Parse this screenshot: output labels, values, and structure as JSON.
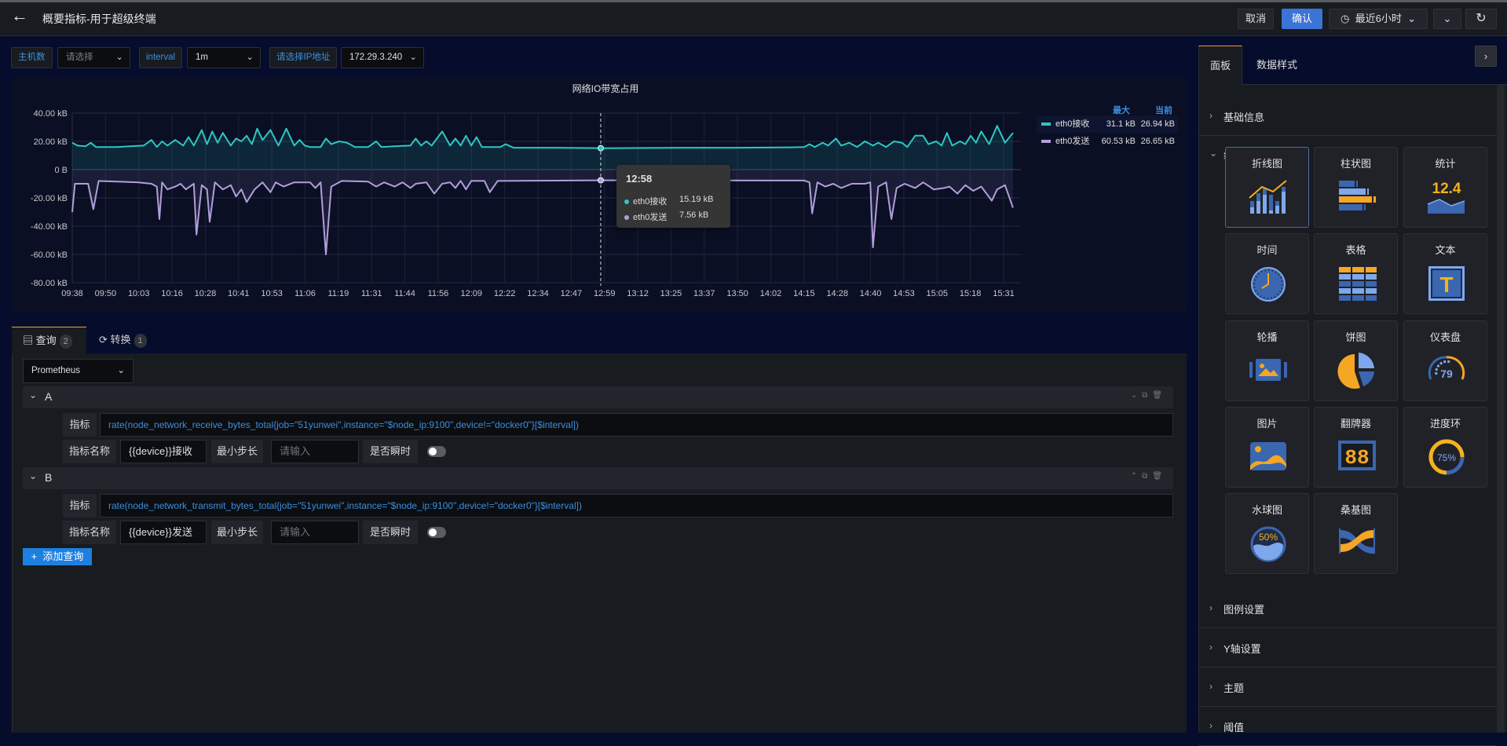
{
  "header": {
    "title": "概要指标-用于超级终端",
    "cancel": "取消",
    "confirm": "确认",
    "time_range": "最近6小时",
    "time_icon": "clock-icon",
    "refresh_icon": "refresh-icon"
  },
  "filters": [
    {
      "label": "主机数",
      "value": "请选择",
      "is_placeholder": true
    },
    {
      "label": "interval",
      "value": "1m"
    },
    {
      "label": "请选择IP地址",
      "value": "172.29.3.240"
    }
  ],
  "chart_data": {
    "type": "line",
    "title": "网络IO带宽占用",
    "ylim": [
      -80,
      40
    ],
    "yticks": [
      "40.00 kB",
      "20.00 kB",
      "0 B",
      "-20.00 kB",
      "-40.00 kB",
      "-60.00 kB",
      "-80.00 kB"
    ],
    "ytick_values": [
      40,
      20,
      0,
      -20,
      -40,
      -60,
      -80
    ],
    "xlim": [
      "09:38",
      "15:37"
    ],
    "xticks": [
      "09:38",
      "09:50",
      "10:03",
      "10:16",
      "10:28",
      "10:41",
      "10:53",
      "11:06",
      "11:19",
      "11:31",
      "11:44",
      "11:56",
      "12:09",
      "12:22",
      "12:34",
      "12:47",
      "12:59",
      "13:12",
      "13:25",
      "13:37",
      "13:50",
      "14:02",
      "14:15",
      "14:28",
      "14:40",
      "14:53",
      "15:05",
      "15:18",
      "15:31"
    ],
    "grid": true,
    "legend_position": "right",
    "legend_headers": {
      "max": "最大",
      "current": "当前"
    },
    "series": [
      {
        "name": "eth0接收",
        "color": "#2cc7c4",
        "max": "31.1 kB",
        "current": "26.94 kB",
        "points": [
          [
            "09:38",
            19
          ],
          [
            "09:40",
            17
          ],
          [
            "09:43",
            16.5
          ],
          [
            "09:45",
            19
          ],
          [
            "09:47",
            16
          ],
          [
            "09:55",
            16
          ],
          [
            "10:00",
            16.5
          ],
          [
            "10:05",
            17
          ],
          [
            "10:08",
            21
          ],
          [
            "10:10",
            16
          ],
          [
            "10:12",
            20
          ],
          [
            "10:14",
            17
          ],
          [
            "10:17",
            21
          ],
          [
            "10:20",
            17
          ],
          [
            "10:22",
            23
          ],
          [
            "10:24",
            17
          ],
          [
            "10:27",
            28
          ],
          [
            "10:29",
            18
          ],
          [
            "10:31",
            27
          ],
          [
            "10:33",
            19
          ],
          [
            "10:35",
            26
          ],
          [
            "10:38",
            17
          ],
          [
            "10:40",
            22
          ],
          [
            "10:42",
            20
          ],
          [
            "10:44",
            24
          ],
          [
            "10:46",
            18
          ],
          [
            "10:48",
            29
          ],
          [
            "10:50",
            21
          ],
          [
            "10:53",
            28
          ],
          [
            "10:56",
            17
          ],
          [
            "10:59",
            29
          ],
          [
            "11:02",
            17
          ],
          [
            "11:04",
            21
          ],
          [
            "11:06",
            17
          ],
          [
            "11:08",
            16
          ],
          [
            "11:12",
            16
          ],
          [
            "11:14",
            22
          ],
          [
            "11:16",
            18
          ],
          [
            "11:19",
            20
          ],
          [
            "11:22",
            19
          ],
          [
            "11:25",
            16
          ],
          [
            "11:30",
            16
          ],
          [
            "11:33",
            20
          ],
          [
            "11:35",
            16
          ],
          [
            "11:40",
            16.5
          ],
          [
            "11:46",
            17
          ],
          [
            "11:48",
            22
          ],
          [
            "11:50",
            17
          ],
          [
            "11:52",
            20
          ],
          [
            "11:54",
            17
          ],
          [
            "11:58",
            27
          ],
          [
            "12:01",
            17
          ],
          [
            "12:03",
            22
          ],
          [
            "12:05",
            17
          ],
          [
            "12:07",
            24
          ],
          [
            "12:09",
            17
          ],
          [
            "12:11",
            23
          ],
          [
            "12:13",
            16
          ],
          [
            "12:20",
            16
          ],
          [
            "12:22",
            18
          ],
          [
            "12:25",
            15.5
          ],
          [
            "12:40",
            15.5
          ],
          [
            "12:58",
            15.19
          ],
          [
            "13:10",
            15.3
          ],
          [
            "13:30",
            15.5
          ],
          [
            "13:50",
            15.5
          ],
          [
            "14:10",
            15.8
          ],
          [
            "14:15",
            16
          ],
          [
            "14:17",
            18
          ],
          [
            "14:19",
            16
          ],
          [
            "14:22",
            19
          ],
          [
            "14:24",
            17
          ],
          [
            "14:27",
            22
          ],
          [
            "14:29",
            17
          ],
          [
            "14:32",
            19
          ],
          [
            "14:35",
            16
          ],
          [
            "14:38",
            20
          ],
          [
            "14:41",
            17
          ],
          [
            "14:43",
            19
          ],
          [
            "14:46",
            16
          ],
          [
            "14:49",
            20
          ],
          [
            "14:52",
            19
          ],
          [
            "14:54",
            16
          ],
          [
            "14:57",
            24
          ],
          [
            "15:00",
            24
          ],
          [
            "15:02",
            18
          ],
          [
            "15:05",
            20
          ],
          [
            "15:07",
            17
          ],
          [
            "15:09",
            26
          ],
          [
            "15:11",
            17
          ],
          [
            "15:14",
            20
          ],
          [
            "15:16",
            18
          ],
          [
            "15:18",
            24
          ],
          [
            "15:20",
            19
          ],
          [
            "15:22",
            27
          ],
          [
            "15:25",
            18
          ],
          [
            "15:28",
            31
          ],
          [
            "15:31",
            19
          ],
          [
            "15:34",
            26
          ]
        ]
      },
      {
        "name": "eth0发送",
        "color": "#b39ddb",
        "max": "60.53 kB",
        "current": "26.65 kB",
        "points": [
          [
            "09:38",
            -30
          ],
          [
            "09:39",
            -10
          ],
          [
            "09:44",
            -10
          ],
          [
            "09:46",
            -28
          ],
          [
            "09:48",
            -8
          ],
          [
            "09:55",
            -8.5
          ],
          [
            "10:03",
            -9
          ],
          [
            "10:08",
            -10
          ],
          [
            "10:10",
            -12
          ],
          [
            "10:11",
            -35
          ],
          [
            "10:12",
            -9
          ],
          [
            "10:14",
            -14
          ],
          [
            "10:17",
            -12
          ],
          [
            "10:19",
            -10
          ],
          [
            "10:21",
            -14
          ],
          [
            "10:24",
            -10
          ],
          [
            "10:25",
            -46
          ],
          [
            "10:27",
            -11
          ],
          [
            "10:29",
            -14
          ],
          [
            "10:30",
            -37
          ],
          [
            "10:32",
            -9
          ],
          [
            "10:35",
            -14
          ],
          [
            "10:38",
            -11
          ],
          [
            "10:40",
            -19
          ],
          [
            "10:42",
            -14
          ],
          [
            "10:44",
            -23
          ],
          [
            "10:47",
            -14
          ],
          [
            "10:50",
            -9
          ],
          [
            "10:53",
            -16
          ],
          [
            "10:55",
            -9
          ],
          [
            "10:58",
            -12
          ],
          [
            "11:02",
            -9
          ],
          [
            "11:08",
            -9
          ],
          [
            "11:10",
            -13
          ],
          [
            "11:12",
            -9
          ],
          [
            "11:14",
            -60
          ],
          [
            "11:16",
            -12
          ],
          [
            "11:20",
            -8
          ],
          [
            "11:30",
            -8.5
          ],
          [
            "11:33",
            -12
          ],
          [
            "11:36",
            -9
          ],
          [
            "11:40",
            -12
          ],
          [
            "11:43",
            -9
          ],
          [
            "11:46",
            -13
          ],
          [
            "11:48",
            -10
          ],
          [
            "11:52",
            -9
          ],
          [
            "11:55",
            -17
          ],
          [
            "11:58",
            -10
          ],
          [
            "12:01",
            -9
          ],
          [
            "12:03",
            -13
          ],
          [
            "12:05",
            -8
          ],
          [
            "12:07",
            -14
          ],
          [
            "12:09",
            -8
          ],
          [
            "12:14",
            -8
          ],
          [
            "12:16",
            -16
          ],
          [
            "12:19",
            -8
          ],
          [
            "12:40",
            -7.8
          ],
          [
            "12:58",
            -7.56
          ],
          [
            "13:30",
            -7.6
          ],
          [
            "14:00",
            -7.7
          ],
          [
            "14:15",
            -7.7
          ],
          [
            "14:17",
            -9
          ],
          [
            "14:18",
            -31
          ],
          [
            "14:20",
            -9
          ],
          [
            "14:23",
            -12
          ],
          [
            "14:26",
            -10
          ],
          [
            "14:29",
            -13
          ],
          [
            "14:33",
            -10
          ],
          [
            "14:38",
            -10
          ],
          [
            "14:40",
            -9
          ],
          [
            "14:41",
            -55
          ],
          [
            "14:43",
            -12
          ],
          [
            "14:46",
            -9
          ],
          [
            "14:48",
            -35
          ],
          [
            "14:50",
            -13
          ],
          [
            "14:53",
            -10
          ],
          [
            "14:57",
            -13
          ],
          [
            "15:00",
            -9
          ],
          [
            "15:04",
            -14
          ],
          [
            "15:08",
            -13
          ],
          [
            "15:10",
            -12
          ],
          [
            "15:13",
            -17
          ],
          [
            "15:16",
            -11
          ],
          [
            "15:19",
            -15
          ],
          [
            "15:22",
            -12
          ],
          [
            "15:26",
            -22
          ],
          [
            "15:28",
            -14
          ],
          [
            "15:31",
            -11
          ],
          [
            "15:34",
            -27
          ]
        ]
      }
    ],
    "tooltip": {
      "time": "12:58",
      "items": [
        {
          "name": "eth0接收",
          "value": "15.19 kB"
        },
        {
          "name": "eth0发送",
          "value": "7.56 kB"
        }
      ]
    }
  },
  "query": {
    "tabs": [
      {
        "label": "查询",
        "count": "2",
        "icon": "list-icon"
      },
      {
        "label": "转换",
        "count": "1",
        "icon": "sync-icon"
      }
    ],
    "datasource": "Prometheus",
    "queries": [
      {
        "id": "A",
        "metric_label": "指标",
        "expr": "rate(node_network_receive_bytes_total{job=\"51yunwei\",instance=\"$node_ip:9100\",device!=\"docker0\"}[$interval])",
        "name_label": "指标名称",
        "name_value": "{{device}}接收",
        "step_label": "最小步长",
        "step_placeholder": "请输入",
        "instant_label": "是否瞬时",
        "instant": false
      },
      {
        "id": "B",
        "metric_label": "指标",
        "expr": "rate(node_network_transmit_bytes_total{job=\"51yunwei\",instance=\"$node_ip:9100\",device!=\"docker0\"}[$interval])",
        "name_label": "指标名称",
        "name_value": "{{device}}发送",
        "step_label": "最小步长",
        "step_placeholder": "请输入",
        "instant_label": "是否瞬时",
        "instant": false
      }
    ],
    "add_label": "添加查询"
  },
  "right_panel": {
    "tabs": [
      "面板",
      "数据样式"
    ],
    "sections_top": [
      {
        "label": "基础信息",
        "expanded": false
      },
      {
        "label": "组件选择",
        "expanded": true
      }
    ],
    "components": [
      {
        "label": "折线图",
        "icon": "line-chart-icon",
        "selected": true
      },
      {
        "label": "柱状图",
        "icon": "bar-chart-icon"
      },
      {
        "label": "统计",
        "icon": "stat-icon",
        "icon_text": "12.4"
      },
      {
        "label": "时间",
        "icon": "clock-icon"
      },
      {
        "label": "表格",
        "icon": "table-icon"
      },
      {
        "label": "文本",
        "icon": "text-icon",
        "icon_text": "T"
      },
      {
        "label": "轮播",
        "icon": "carousel-icon"
      },
      {
        "label": "饼图",
        "icon": "pie-chart-icon"
      },
      {
        "label": "仪表盘",
        "icon": "gauge-icon",
        "icon_text": "79"
      },
      {
        "label": "图片",
        "icon": "image-icon"
      },
      {
        "label": "翻牌器",
        "icon": "flip-counter-icon",
        "icon_text": "88"
      },
      {
        "label": "进度环",
        "icon": "progress-ring-icon",
        "icon_text": "75%"
      },
      {
        "label": "水球图",
        "icon": "liquid-fill-icon",
        "icon_text": "50%"
      },
      {
        "label": "桑基图",
        "icon": "sankey-icon"
      }
    ],
    "sections_bottom": [
      {
        "label": "图例设置"
      },
      {
        "label": "Y轴设置"
      },
      {
        "label": "主题"
      },
      {
        "label": "阈值"
      }
    ]
  }
}
